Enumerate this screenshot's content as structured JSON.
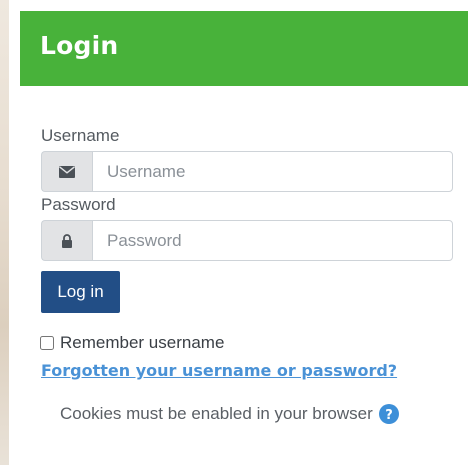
{
  "header": {
    "title": "Login"
  },
  "form": {
    "username_label": "Username",
    "username_placeholder": "Username",
    "username_value": "",
    "username_icon": "envelope-icon",
    "password_label": "Password",
    "password_placeholder": "Password",
    "password_value": "",
    "password_icon": "lock-icon",
    "login_button_label": "Log in",
    "remember_label": "Remember username",
    "remember_checked": false,
    "forgot_link_text": "Forgotten your username or password?",
    "cookies_text": "Cookies must be enabled in your browser",
    "cookies_help_icon": "question-circle-icon"
  },
  "colors": {
    "header_bg": "#48b23a",
    "header_text": "#ffffff",
    "button_bg": "#224e86",
    "link": "#4a92d6",
    "help_icon": "#3d8fd8"
  }
}
